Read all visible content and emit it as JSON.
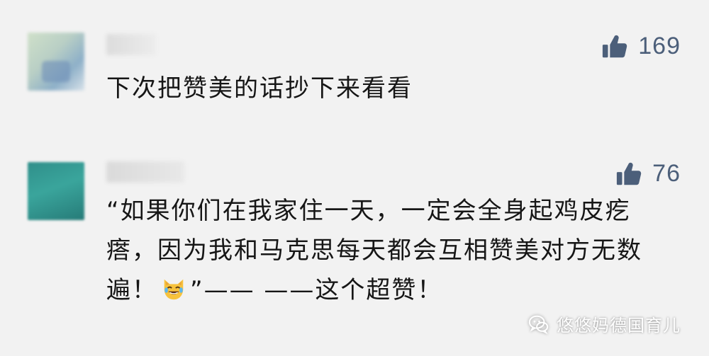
{
  "comments": [
    {
      "likes": "169",
      "text": "下次把赞美的话抄下来看看"
    },
    {
      "likes": "76",
      "text_part1": "“如果你们在我家住一天，一定会全身起鸡皮疙瘩，因为我和马克思每天都会互相赞美对方无数遍！",
      "emoji": "joy-cat-icon",
      "text_part2": "”—— ——这个超赞！"
    }
  ],
  "watermark": {
    "label": "悠悠妈德国育儿"
  },
  "colors": {
    "background": "#f2f2f2",
    "like_color": "#4c5f7a",
    "text_color": "#161616"
  }
}
